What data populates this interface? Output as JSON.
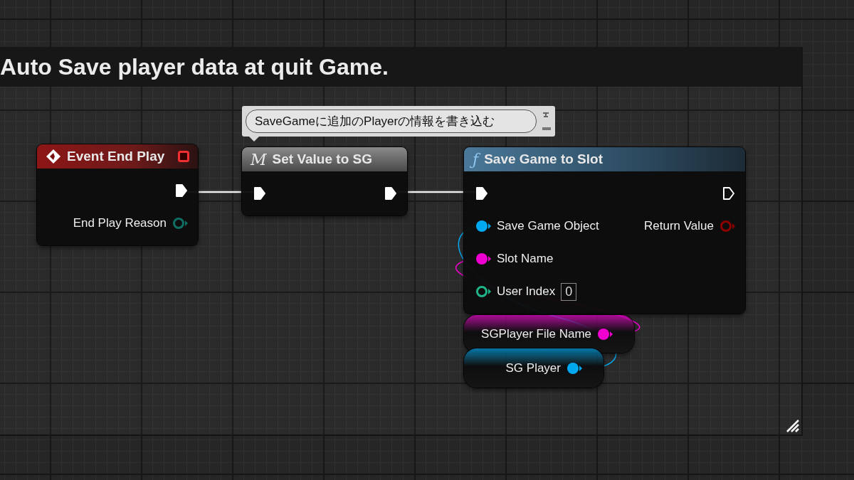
{
  "comment_box": {
    "title": "Auto Save player data at quit Game."
  },
  "node_comment": {
    "text": "SaveGameに追加のPlayerの情報を書き込む"
  },
  "nodes": [
    {
      "kind": "event",
      "title": "Event End Play",
      "rows": [
        {
          "right": {
            "kind": "exec",
            "connected": true
          }
        },
        {
          "right": {
            "kind": "data",
            "label": "End Play Reason",
            "color": "#0f6f64",
            "connected": false
          }
        }
      ]
    },
    {
      "kind": "macro",
      "glyph": "M",
      "title": "Set Value to SG",
      "rows": [
        {
          "left": {
            "kind": "exec",
            "connected": true
          },
          "right": {
            "kind": "exec",
            "connected": true
          }
        }
      ]
    },
    {
      "kind": "function",
      "glyph": "ƒ",
      "title": "Save Game to Slot",
      "rows": [
        {
          "left": {
            "kind": "exec",
            "connected": true
          },
          "right": {
            "kind": "exec",
            "connected": false
          }
        },
        {
          "left": {
            "kind": "data",
            "label": "Save Game Object",
            "color": "#00a8f0",
            "connected": true
          },
          "right": {
            "kind": "data",
            "label": "Return Value",
            "color": "#8c0000",
            "connected": false
          }
        },
        {
          "left": {
            "kind": "data",
            "label": "Slot Name",
            "color": "#f000d0",
            "connected": true
          }
        },
        {
          "left": {
            "kind": "data",
            "label": "User Index",
            "color": "#1fb58a",
            "connected": false,
            "value": "0"
          }
        }
      ]
    }
  ],
  "variables": [
    {
      "label": "SGPlayer File Name",
      "color": "#f000d0"
    },
    {
      "label": "SG Player",
      "color": "#00a8f0"
    }
  ]
}
